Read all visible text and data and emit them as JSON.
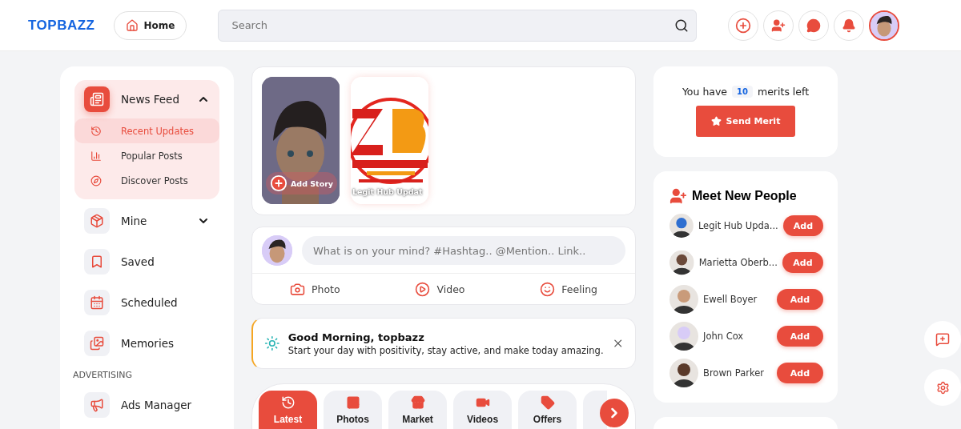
{
  "header": {
    "logo": "TOPBAZZ",
    "home_button": "Home",
    "search": {
      "placeholder": "Search"
    }
  },
  "sidebar": {
    "items": [
      {
        "label": "News Feed",
        "expanded": true,
        "selected": true,
        "children": [
          {
            "label": "Recent Updates",
            "selected": true
          },
          {
            "label": "Popular Posts",
            "selected": false
          },
          {
            "label": "Discover Posts",
            "selected": false
          }
        ]
      },
      {
        "label": "Mine",
        "expanded": false,
        "selected": false
      },
      {
        "label": "Saved",
        "selected": false
      },
      {
        "label": "Scheduled",
        "selected": false
      },
      {
        "label": "Memories",
        "selected": false
      }
    ],
    "section": "ADVERTISING",
    "section_items": [
      {
        "label": "Ads Manager",
        "selected": false
      }
    ]
  },
  "stories": [
    {
      "kind": "add",
      "label": "Add Story"
    },
    {
      "kind": "story",
      "label": "Legit Hub Updat"
    }
  ],
  "composer": {
    "placeholder": "What is on your mind? #Hashtag.. @Mention.. Link..",
    "actions": [
      "Photo",
      "Video",
      "Feeling"
    ]
  },
  "greeting": {
    "title": "Good Morning, topbazz",
    "message": "Start your day with positivity, stay active, and make today amazing."
  },
  "feed_tabs": [
    {
      "label": "Latest",
      "selected": true
    },
    {
      "label": "Photos",
      "selected": false
    },
    {
      "label": "Market",
      "selected": false
    },
    {
      "label": "Videos",
      "selected": false
    },
    {
      "label": "Offers",
      "selected": false
    }
  ],
  "merits": {
    "prefix": "You have",
    "count": "10",
    "suffix": "merits left",
    "button": "Send Merit"
  },
  "people": {
    "title": "Meet New People",
    "items": [
      {
        "name": "Legit Hub Upda...",
        "button": "Add"
      },
      {
        "name": "Marietta Oberb...",
        "button": "Add"
      },
      {
        "name": "Ewell Boyer",
        "button": "Add"
      },
      {
        "name": "John Cox",
        "button": "Add"
      },
      {
        "name": "Brown Parker",
        "button": "Add"
      }
    ]
  }
}
